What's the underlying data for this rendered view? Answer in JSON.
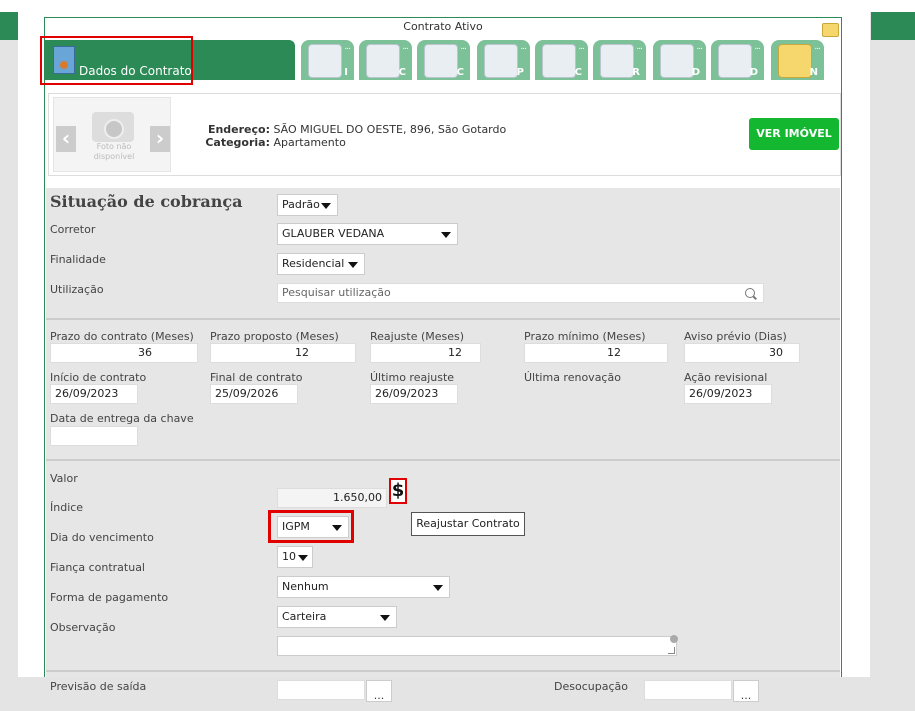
{
  "panel": {
    "title": "Contrato Ativo"
  },
  "tabs": {
    "active": {
      "label": "Dados do Contrato"
    },
    "items": [
      {
        "letter": "I"
      },
      {
        "letter": "C"
      },
      {
        "letter": "C"
      },
      {
        "letter": "P"
      },
      {
        "letter": "C"
      },
      {
        "letter": "R"
      },
      {
        "letter": "D"
      },
      {
        "letter": "D"
      },
      {
        "letter": "N"
      }
    ],
    "ellipsis": "..."
  },
  "property": {
    "photo_text": "Foto não disponível",
    "prev_arrow": "‹",
    "next_arrow": "›",
    "endereco_label": "Endereço:",
    "endereco_value": "SÃO MIGUEL DO OESTE, 896, São Gotardo",
    "categoria_label": "Categoria:",
    "categoria_value": "Apartamento",
    "ver_imovel": "VER IMÓVEL"
  },
  "form": {
    "section_title": "Situação de cobrança",
    "situacao_value": "Padrão",
    "corretor_label": "Corretor",
    "corretor_value": "GLAUBER VEDANA",
    "finalidade_label": "Finalidade",
    "finalidade_value": "Residencial",
    "utilizacao_label": "Utilização",
    "utilizacao_placeholder": "Pesquisar utilização",
    "prazo_contrato_label": "Prazo do contrato (Meses)",
    "prazo_contrato_value": "36",
    "prazo_proposto_label": "Prazo proposto (Meses)",
    "prazo_proposto_value": "12",
    "reajuste_label": "Reajuste (Meses)",
    "reajuste_value": "12",
    "prazo_minimo_label": "Prazo mínimo (Meses)",
    "prazo_minimo_value": "12",
    "aviso_previo_label": "Aviso prévio (Dias)",
    "aviso_previo_value": "30",
    "inicio_label": "Início de contrato",
    "inicio_value": "26/09/2023",
    "final_label": "Final de contrato",
    "final_value": "25/09/2026",
    "ultimo_reajuste_label": "Último reajuste",
    "ultimo_reajuste_value": "26/09/2023",
    "ultima_renovacao_label": "Última renovação",
    "acao_revisional_label": "Ação revisional",
    "acao_revisional_value": "26/09/2023",
    "entrega_chave_label": "Data de entrega da chave",
    "valor_label": "Valor",
    "valor_value": "1.650,00",
    "dollar": "$",
    "tooltip": "Reajustar Contrato",
    "indice_label": "Índice",
    "indice_value": "IGPM",
    "vencimento_label": "Dia do vencimento",
    "vencimento_value": "10",
    "fianca_label": "Fiança contratual",
    "fianca_value": "Nenhum",
    "pagamento_label": "Forma de pagamento",
    "pagamento_value": "Carteira",
    "observacao_label": "Observação",
    "previsao_label": "Previsão de saída",
    "desocupacao_label": "Desocupação",
    "dots": "..."
  },
  "colors": {
    "green": "#2b8a55",
    "tab_green": "#7cc198",
    "button_green": "#13b830",
    "highlight": "#e00000"
  }
}
